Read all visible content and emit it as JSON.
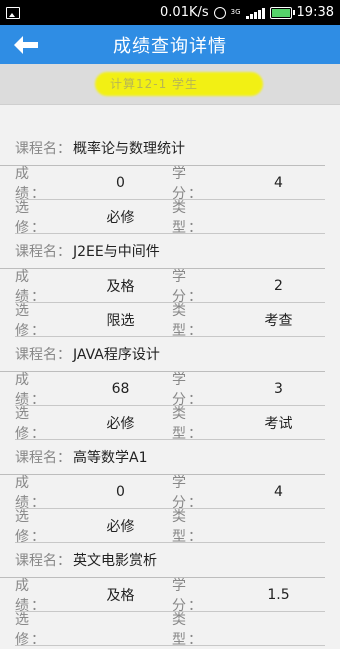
{
  "status": {
    "speed": "0.01K/s",
    "network": "3G",
    "time": "19:38"
  },
  "header": {
    "title": "成绩查询详情",
    "back_icon": "back-arrow-icon"
  },
  "banner": {
    "student_text": "计算12-1 学生"
  },
  "labels": {
    "course": "课程名：",
    "score": "成　绩：",
    "credit": "学　分：",
    "elective": "选　修：",
    "type": "类　型："
  },
  "courses": [
    {
      "name": "概率论与数理统计",
      "score": "0",
      "credit": "4",
      "elective": "必修",
      "type": ""
    },
    {
      "name": "J2EE与中间件",
      "score": "及格",
      "credit": "2",
      "elective": "限选",
      "type": "考查"
    },
    {
      "name": "JAVA程序设计",
      "score": "68",
      "credit": "3",
      "elective": "必修",
      "type": "考试"
    },
    {
      "name": "高等数学A1",
      "score": "0",
      "credit": "4",
      "elective": "必修",
      "type": ""
    },
    {
      "name": "英文电影赏析",
      "score": "及格",
      "credit": "1.5",
      "elective": "",
      "type": ""
    }
  ]
}
